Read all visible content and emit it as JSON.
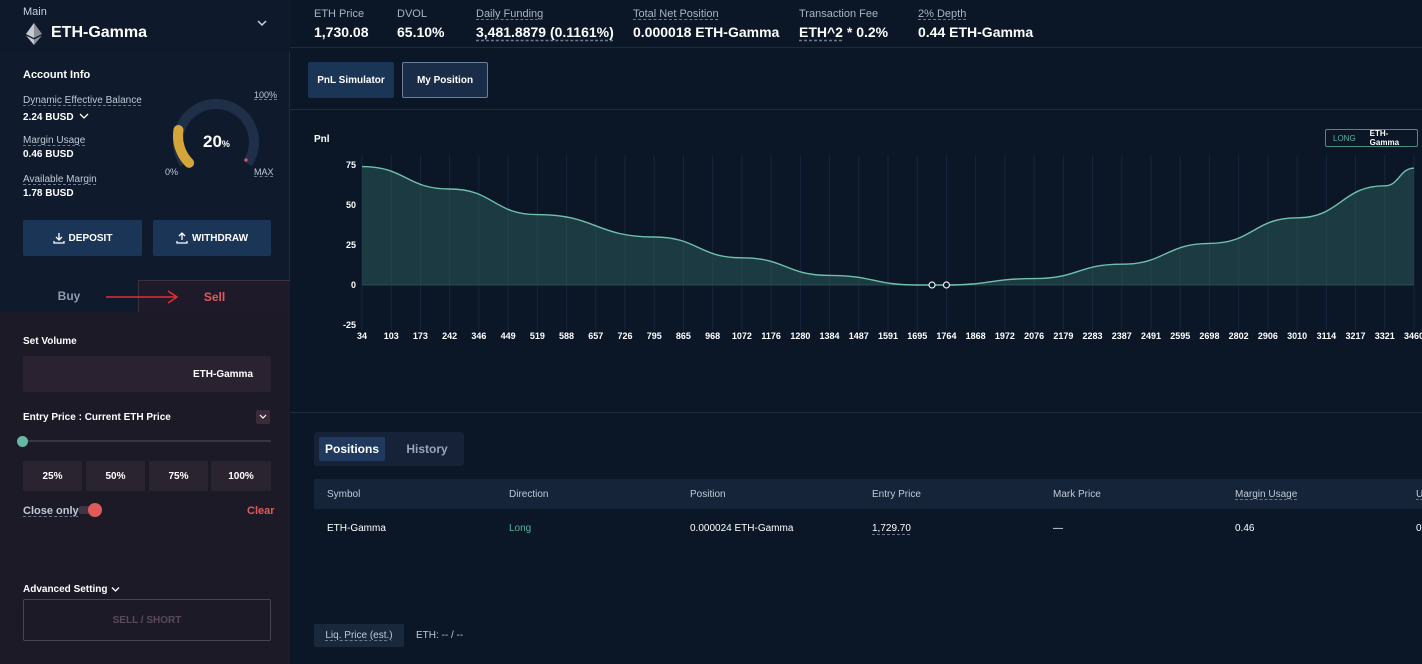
{
  "market": {
    "label": "Main",
    "name": "ETH-Gamma"
  },
  "account": {
    "title": "Account Info",
    "deb_label": "Dynamic Effective Balance",
    "deb_value": "2.24 BUSD",
    "mu_label": "Margin Usage",
    "mu_value": "0.46 BUSD",
    "am_label": "Available Margin",
    "am_value": "1.78 BUSD"
  },
  "gauge": {
    "value": "20",
    "unit": "%",
    "fill_fraction": 0.2,
    "top_label": "100%",
    "min_label": "0%",
    "max_label": "MAX"
  },
  "actions": {
    "deposit": "DEPOSIT",
    "withdraw": "WITHDRAW"
  },
  "side_tabs": {
    "buy": "Buy",
    "sell": "Sell"
  },
  "order": {
    "set_volume": "Set Volume",
    "volume_unit": "ETH-Gamma",
    "entry_price": "Entry Price : Current ETH Price",
    "slider_fraction": 0,
    "pct_buttons": [
      "25%",
      "50%",
      "75%",
      "100%"
    ],
    "close_only": "Close only",
    "clear": "Clear",
    "advanced": "Advanced Setting",
    "submit": "SELL / SHORT"
  },
  "header": {
    "stats": [
      {
        "label": "ETH Price",
        "value": "1,730.08"
      },
      {
        "label": "DVOL",
        "value": "65.10%"
      },
      {
        "label": "Daily Funding",
        "value": "3,481.8879 (0.1161%)"
      },
      {
        "label": "Total Net Position",
        "value": "0.000018 ETH-Gamma"
      },
      {
        "label": "Transaction Fee",
        "value_a": "ETH^2",
        "value_b": " * 0.2%"
      },
      {
        "label": "2% Depth",
        "value": "0.44 ETH-Gamma"
      }
    ]
  },
  "view_tabs": {
    "pnl": "PnL Simulator",
    "position": "My Position"
  },
  "legend": {
    "direction": "LONG",
    "asset": "ETH-Gamma"
  },
  "colors": {
    "accent_green": "#5ab39e",
    "sell_red": "#e05a5a",
    "button_blue": "#1b3556"
  },
  "chart_data": {
    "type": "area",
    "ylabel": "Pnl",
    "yticks": [
      75,
      50,
      25,
      0,
      -25
    ],
    "ylim": [
      -25,
      75
    ],
    "xticks": [
      "34",
      "103",
      "173",
      "242",
      "346",
      "449",
      "519",
      "588",
      "657",
      "726",
      "795",
      "865",
      "968",
      "1072",
      "1176",
      "1280",
      "1384",
      "1487",
      "1591",
      "1695",
      "1764",
      "1868",
      "1972",
      "2076",
      "2179",
      "2283",
      "2387",
      "2491",
      "2595",
      "2698",
      "2802",
      "2906",
      "3010",
      "3114",
      "3217",
      "3321",
      "3460"
    ],
    "xlim": [
      34,
      3460
    ],
    "series": [
      {
        "name": "ETH-Gamma",
        "x": [
          34,
          242,
          519,
          795,
          1072,
          1384,
          1695,
          1764,
          2076,
          2387,
          2698,
          3010,
          3321,
          3460
        ],
        "y": [
          74,
          60,
          44,
          30,
          17,
          6,
          0,
          0,
          4,
          13,
          26,
          42,
          62,
          73
        ]
      }
    ],
    "markers": [
      {
        "x": 1730,
        "y": 0
      },
      {
        "x": 1764,
        "y": 0
      }
    ],
    "grid": true,
    "legend": "top-right"
  },
  "positions": {
    "tabs": [
      "Positions",
      "History"
    ],
    "columns": [
      "Symbol",
      "Direction",
      "Position",
      "Entry Price",
      "Mark Price",
      "Margin Usage",
      "U"
    ],
    "rows": [
      {
        "symbol": "ETH-Gamma",
        "direction": "Long",
        "position": "0.000024 ETH-Gamma",
        "entry": "1,729.70",
        "mark": "—",
        "margin": "0.46",
        "u": "0"
      }
    ],
    "liq_label": "Liq. Price (est.)",
    "liq_value": "ETH: -- / --"
  }
}
